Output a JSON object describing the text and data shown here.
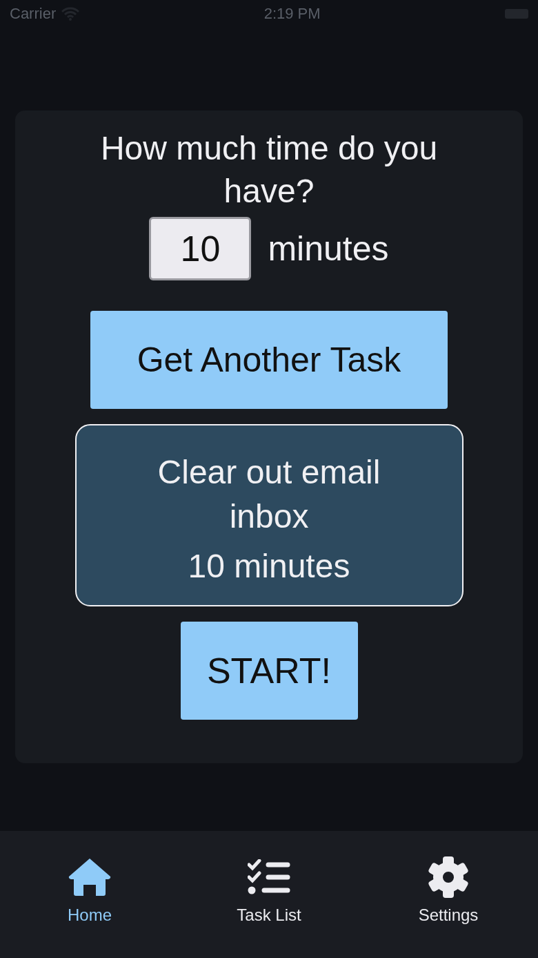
{
  "status_bar": {
    "carrier": "Carrier",
    "time": "2:19 PM"
  },
  "prompt": "How much time do you have?",
  "duration_field": {
    "value": "10"
  },
  "unit": "minutes",
  "get_task_button": "Get Another Task",
  "task": {
    "title": "Clear out email inbox",
    "duration": "10 minutes"
  },
  "start_button": "START!",
  "tabs": [
    {
      "label": "Home",
      "kind": "home",
      "selected": true
    },
    {
      "label": "Task List",
      "kind": "list",
      "selected": false
    },
    {
      "label": "Settings",
      "kind": "settings",
      "selected": false
    }
  ]
}
